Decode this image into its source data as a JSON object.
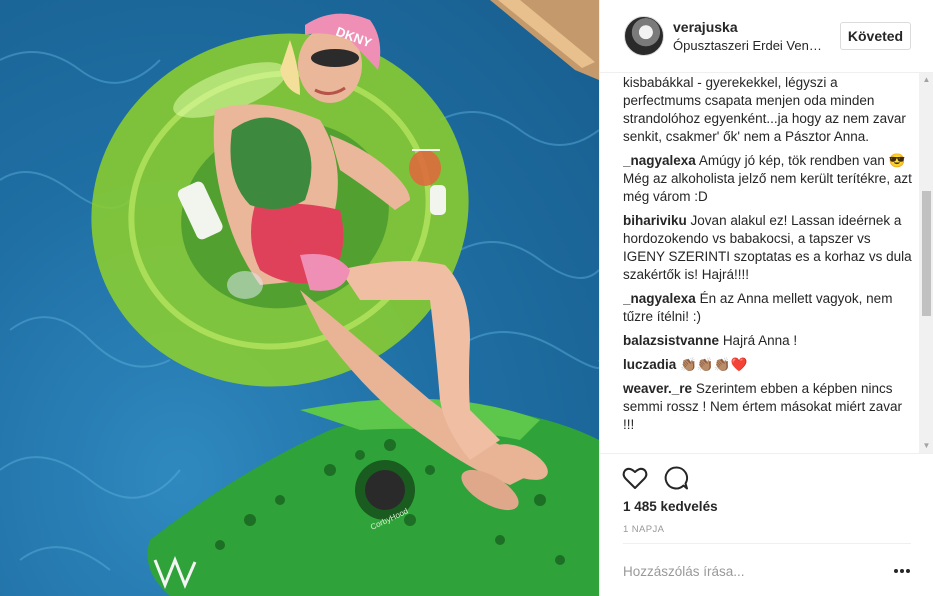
{
  "post": {
    "username": "verajuska",
    "location": "Ópusztaszeri Erdei Vendégház",
    "follow_label": "Követed"
  },
  "comments": {
    "first_text": "kisbabákkal - gyerekekkel, légyszi a perfectmums csapata menjen oda minden strandolóhoz egyenként...ja hogy az nem zavar senkit, csakmer' ők' nem a Pásztor Anna.",
    "items": [
      {
        "author": "_nagyalexa",
        "text": "Amúgy jó kép, tök rendben van 😎 Még az alkoholista jelző nem került terítékre, azt még várom :D"
      },
      {
        "author": "bihariviku",
        "text": "Jovan alakul ez! Lassan ideérnek a hordozokendo vs babakocsi, a tapszer vs IGENY SZERINTI szoptatas es a korhaz vs dula szakértők is! Hajrá!!!!"
      },
      {
        "author": "_nagyalexa",
        "text": "Én az Anna mellett vagyok, nem tűzre ítélni! :)"
      },
      {
        "author": "balazsistvanne",
        "text": "Hajrá Anna !"
      },
      {
        "author": "luczadia",
        "text": "👏🏽👏🏽👏🏽❤️"
      },
      {
        "author": "weaver._re",
        "text": "Szerintem ebben a képben nincs semmi rossz ! Nem értem másokat miért zavar !!!"
      }
    ]
  },
  "actions": {
    "likes": "1 485 kedvelés",
    "timestamp": "1 NAPJA",
    "comment_placeholder": "Hozzászólás írása...",
    "icons": [
      "heart-icon",
      "comment-icon",
      "more-options-icon"
    ]
  },
  "photo": {
    "cap_text": "DKNY",
    "float_text": "CorbyHood"
  },
  "colors": {
    "water": "#1f6fa4",
    "float": "#8fd12a",
    "crocodile": "#2fa33a",
    "cap": "#f08fb5",
    "swimsuit": "#e0415a"
  }
}
